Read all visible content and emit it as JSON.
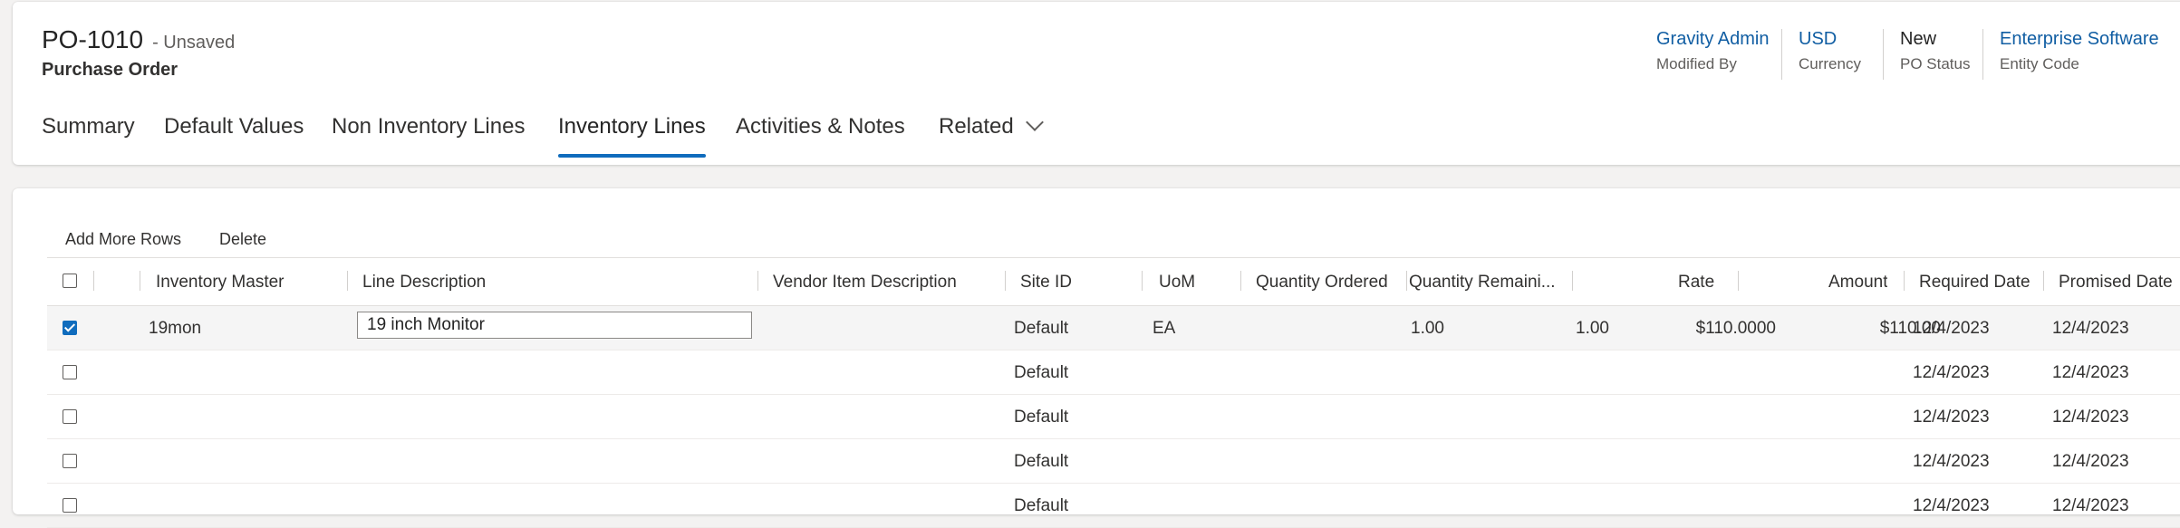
{
  "header": {
    "title": "PO-1010",
    "status_text": "- Unsaved",
    "subtitle": "Purchase Order",
    "fields": [
      {
        "value": "Gravity Admin",
        "label": "Modified By",
        "link": true
      },
      {
        "value": "USD",
        "label": "Currency",
        "link": true
      },
      {
        "value": "New",
        "label": "PO Status",
        "link": false
      },
      {
        "value": "Enterprise Software",
        "label": "Entity Code",
        "link": true
      }
    ]
  },
  "tabs": [
    "Summary",
    "Default Values",
    "Non Inventory Lines",
    "Inventory Lines",
    "Activities & Notes",
    "Related"
  ],
  "active_tab": "Inventory Lines",
  "commands": {
    "add_rows": "Add More Rows",
    "delete": "Delete"
  },
  "grid": {
    "columns": [
      "Inventory Master",
      "Line Description",
      "Vendor Item Description",
      "Site ID",
      "UoM",
      "Quantity Ordered",
      "Quantity Remaini...",
      "Rate",
      "Amount",
      "Required Date",
      "Promised Date"
    ],
    "rows": [
      {
        "checked": true,
        "inventory_master": "19mon",
        "line_description": "19 inch Monitor",
        "vendor_item_description": "",
        "site_id": "Default",
        "uom": "EA",
        "qty_ordered": "1.00",
        "qty_remaining": "1.00",
        "rate": "$110.0000",
        "amount": "$110.00",
        "required_date": "12/4/2023",
        "promised_date": "12/4/2023"
      },
      {
        "checked": false,
        "inventory_master": "",
        "line_description": "",
        "vendor_item_description": "",
        "site_id": "Default",
        "uom": "",
        "qty_ordered": "",
        "qty_remaining": "",
        "rate": "",
        "amount": "",
        "required_date": "12/4/2023",
        "promised_date": "12/4/2023"
      },
      {
        "checked": false,
        "inventory_master": "",
        "line_description": "",
        "vendor_item_description": "",
        "site_id": "Default",
        "uom": "",
        "qty_ordered": "",
        "qty_remaining": "",
        "rate": "",
        "amount": "",
        "required_date": "12/4/2023",
        "promised_date": "12/4/2023"
      },
      {
        "checked": false,
        "inventory_master": "",
        "line_description": "",
        "vendor_item_description": "",
        "site_id": "Default",
        "uom": "",
        "qty_ordered": "",
        "qty_remaining": "",
        "rate": "",
        "amount": "",
        "required_date": "12/4/2023",
        "promised_date": "12/4/2023"
      },
      {
        "checked": false,
        "inventory_master": "",
        "line_description": "",
        "vendor_item_description": "",
        "site_id": "Default",
        "uom": "",
        "qty_ordered": "",
        "qty_remaining": "",
        "rate": "",
        "amount": "",
        "required_date": "12/4/2023",
        "promised_date": "12/4/2023"
      }
    ]
  },
  "colors": {
    "accent": "#0f6cbd",
    "link": "#115ea3"
  }
}
